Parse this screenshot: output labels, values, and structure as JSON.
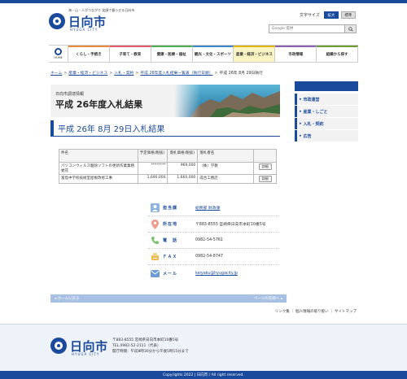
{
  "header": {
    "tagline": "海・山・人がつながり 笑顔で暮らせる日向市",
    "logo_text": "日向市",
    "logo_sub": "HYUGA CITY",
    "font_size_label": "文字サイズ",
    "font_large": "拡大",
    "font_standard": "標準",
    "search_placeholder": "Google 提供",
    "search_icon": "search-icon"
  },
  "nav": {
    "home_label": "HOME",
    "items": [
      {
        "label": "くらし・手続き"
      },
      {
        "label": "子育て・教育"
      },
      {
        "label": "健康・医療・福祉"
      },
      {
        "label": "観光・文化・スポーツ"
      },
      {
        "label": "産業・経済・ビジネス"
      },
      {
        "label": "市政情報"
      },
      {
        "label": "組織から探す"
      }
    ]
  },
  "breadcrumb": {
    "items": [
      "ホーム",
      "産業・経済・ビジネス",
      "入札・契約",
      "平成 26年度入札結果一覧表（執行日順）"
    ],
    "current": "平成 26年 8月 29日執行"
  },
  "banner": {
    "small": "日向市調達情報",
    "big": "平成 26年度入札結果"
  },
  "page_title": "平成 26年 8月 29日入札結果",
  "table": {
    "headers": [
      "件名",
      "予定価格(税抜)",
      "落札価格(税抜)",
      "落札者名",
      ""
    ],
    "rows": [
      {
        "name": "パソコンウィルス駆除ソフトの更新作業業務委託",
        "planned": "********",
        "winning": "969,000",
        "winner": "（株）学教",
        "action": "詳細"
      },
      {
        "name": "富島中学校技術室屋根改修工事",
        "planned": "1,690,000",
        "winning": "1,660,000",
        "winner": "成合工務店",
        "action": "詳細"
      }
    ]
  },
  "contact": {
    "rows": [
      {
        "icon": "person-icon",
        "label": "担当課",
        "value": "総務部 財政課",
        "link": true
      },
      {
        "icon": "location-pin-icon",
        "label": "所在地",
        "value": "〒883-8555 宮崎県日向市本町10番5号",
        "link": false
      },
      {
        "icon": "phone-icon",
        "label": "電　話",
        "value": "0982-54-5761",
        "link": false
      },
      {
        "icon": "fax-icon",
        "label": "ＦＡＸ",
        "value": "0982-54-8747",
        "link": false
      },
      {
        "icon": "mail-icon",
        "label": "メール",
        "value": "keiyaku@hyugacity.jp",
        "link": true
      }
    ]
  },
  "pagebar": {
    "back": "ホームに戻る",
    "top": "ページの先頭へ"
  },
  "footlinks": {
    "text": "リンク集 ｜ 個人情報の取り扱い ｜ サイトマップ"
  },
  "sidebar": {
    "items": [
      "市政運営",
      "産業・しごと",
      "入札・契約",
      "広告"
    ]
  },
  "footer": {
    "logo_text": "日向市",
    "logo_sub": "HYUGA CITY",
    "address": "〒883-8555 宮崎県日向市本町10番5号",
    "tel": "TEL.0982-52-2111（代表）",
    "hours": "開庁時間：午前8時30分から午後5時15分まで",
    "copyright": "Copyrights 2022 | 日向市 / All right reserved."
  },
  "colors": {
    "brand": "#1a4a9b",
    "nav_active": "#fdf4c4",
    "pagebar": "#a8c0e3"
  }
}
